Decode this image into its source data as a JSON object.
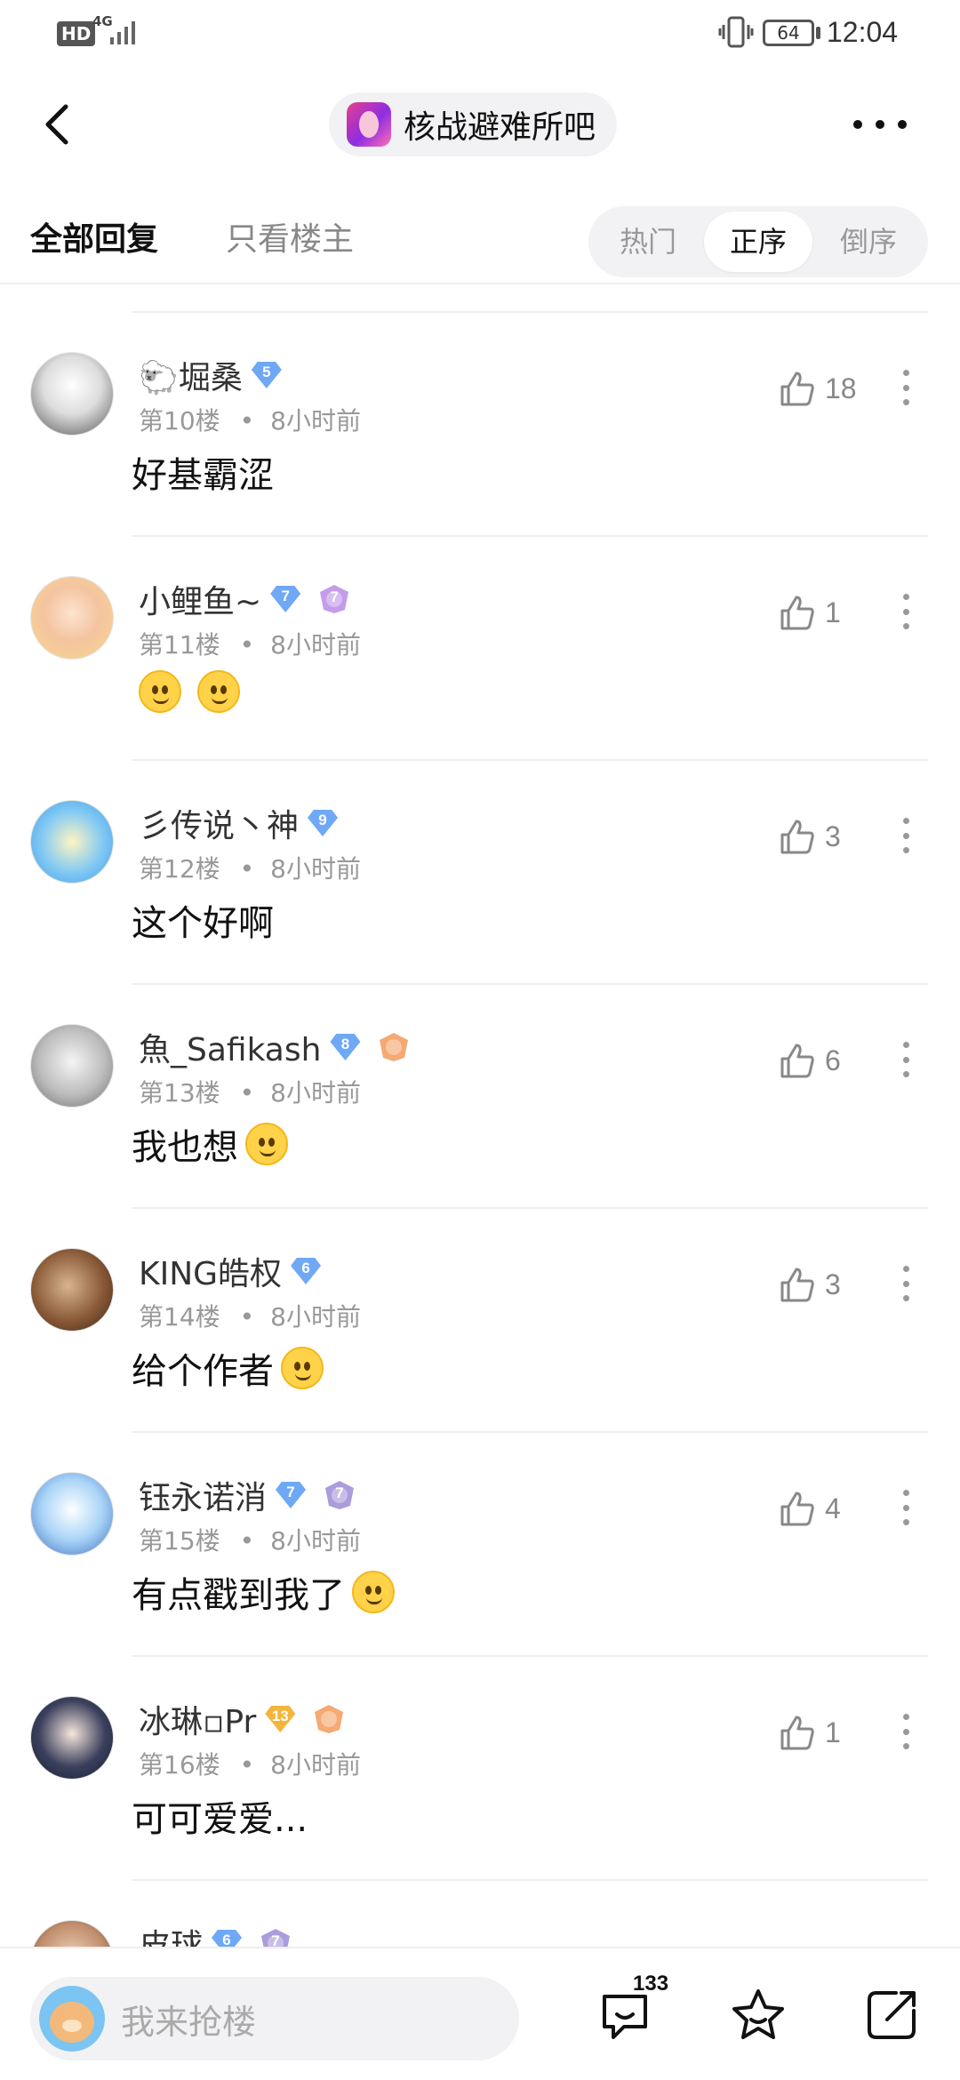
{
  "status_bar": {
    "hd": "HD",
    "network": "4G",
    "battery": "64",
    "time": "12:04"
  },
  "header": {
    "forum_name": "核战避难所吧"
  },
  "tabs": {
    "all_replies": "全部回复",
    "owner_only": "只看楼主"
  },
  "sort": {
    "hot": "热门",
    "ascending": "正序",
    "descending": "倒序",
    "active": "正序"
  },
  "comments": [
    {
      "username": "🐑堀桑",
      "level": "5",
      "level_color": "#6fa8f5",
      "badge": false,
      "floor": "第10楼",
      "time": "8小时前",
      "text": "好基霸涩",
      "emojis": 0,
      "likes": "18"
    },
    {
      "username": "小鲤鱼~",
      "level": "7",
      "level_color": "#6fa8f5",
      "badge": true,
      "badge_color": "#b88be6",
      "badge_text": "7",
      "floor": "第11楼",
      "time": "8小时前",
      "text": "",
      "emojis": 2,
      "likes": "1"
    },
    {
      "username": "彡传说丶神",
      "level": "9",
      "level_color": "#6fa8f5",
      "badge": false,
      "floor": "第12楼",
      "time": "8小时前",
      "text": "这个好啊",
      "emojis": 0,
      "likes": "3"
    },
    {
      "username": "魚_Safikash",
      "level": "8",
      "level_color": "#6fa8f5",
      "badge": true,
      "badge_color": "#f39a5b",
      "badge_text": "",
      "floor": "第13楼",
      "time": "8小时前",
      "text": "我也想",
      "emojis": 1,
      "likes": "6"
    },
    {
      "username": "KING皓权",
      "level": "6",
      "level_color": "#6fa8f5",
      "badge": false,
      "floor": "第14楼",
      "time": "8小时前",
      "text": "给个作者",
      "emojis": 1,
      "likes": "3"
    },
    {
      "username": "钰永诺消",
      "level": "7",
      "level_color": "#6fa8f5",
      "badge": true,
      "badge_color": "#9c8bd6",
      "badge_text": "7",
      "floor": "第15楼",
      "time": "8小时前",
      "text": "有点戳到我了",
      "emojis": 1,
      "likes": "4"
    },
    {
      "username": "冰琳▫Pr",
      "level": "13",
      "level_color": "#f5b43c",
      "badge": true,
      "badge_color": "#f39a5b",
      "badge_text": "",
      "floor": "第16楼",
      "time": "8小时前",
      "text": "可可爱爱...",
      "emojis": 0,
      "likes": "1"
    },
    {
      "username": "皮球",
      "level": "6",
      "level_color": "#6fa8f5",
      "badge": true,
      "badge_color": "#9c8bd6",
      "badge_text": "7",
      "floor": "",
      "time": "",
      "text": "",
      "emojis": 0,
      "likes": ""
    }
  ],
  "bottom_bar": {
    "reply_placeholder": "我来抢楼",
    "comment_count": "133"
  },
  "colors": {
    "accent_blue": "#6fa8f5",
    "accent_gold": "#f5b43c",
    "text_gray": "#999999"
  },
  "icons": [
    "back-icon",
    "more-icon",
    "like-icon",
    "kebab-icon",
    "comment-icon",
    "star-icon",
    "share-icon"
  ]
}
